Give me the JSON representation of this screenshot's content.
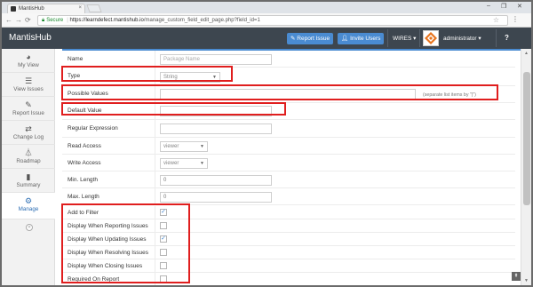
{
  "browser": {
    "tab_title": "MantisHub",
    "tab_close": "×",
    "secure_label": "Secure",
    "url_host": "https://learndefect.mantishub.io",
    "url_path": "/manage_custom_field_edit_page.php?field_id=1",
    "window_controls": [
      "–",
      "❐",
      "✕"
    ]
  },
  "navbar": {
    "brand": "MantisHub",
    "report_issue": "Report Issue",
    "invite_users": "Invite Users",
    "project": "WIRES ▾",
    "user": "administrator ▾",
    "help": "?"
  },
  "sidebar": {
    "items": [
      {
        "label": "My View",
        "icon": "dashboard-icon"
      },
      {
        "label": "View Issues",
        "icon": "list-icon"
      },
      {
        "label": "Report Issue",
        "icon": "edit-icon"
      },
      {
        "label": "Change Log",
        "icon": "retweet-icon"
      },
      {
        "label": "Roadmap",
        "icon": "road-icon"
      },
      {
        "label": "Summary",
        "icon": "bar-chart-icon"
      },
      {
        "label": "Manage",
        "icon": "gears-icon"
      }
    ],
    "active": "Manage"
  },
  "form": {
    "name_label": "Name",
    "name_placeholder": "Package Name",
    "type_label": "Type",
    "type_value": "String",
    "possible_values_label": "Possible Values",
    "possible_values_hint": "(separate list items by \"|\")",
    "default_value_label": "Default Value",
    "regex_label": "Regular Expression",
    "read_access_label": "Read Access",
    "read_access_value": "viewer",
    "write_access_label": "Write Access",
    "write_access_value": "viewer",
    "min_length_label": "Min. Length",
    "min_length_value": "0",
    "max_length_label": "Max. Length",
    "max_length_value": "0",
    "checkboxes": [
      {
        "label": "Add to Filter",
        "checked": true
      },
      {
        "label": "Display When Reporting Issues",
        "checked": false
      },
      {
        "label": "Display When Updating Issues",
        "checked": true
      },
      {
        "label": "Display When Resolving Issues",
        "checked": false
      },
      {
        "label": "Display When Closing Issues",
        "checked": false
      },
      {
        "label": "Required On Report",
        "checked": false
      }
    ]
  },
  "colors": {
    "navbar": "#3d464f",
    "accent": "#4a8bd1",
    "annotation": "#e01e1e"
  }
}
